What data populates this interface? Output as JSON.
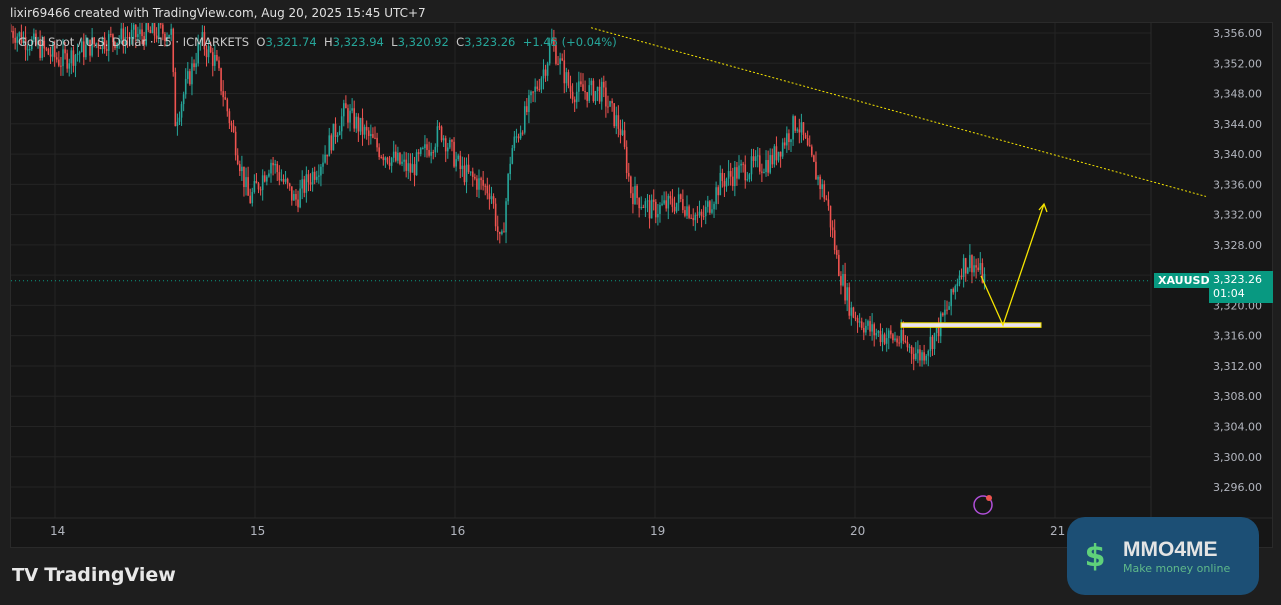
{
  "header": {
    "text": "lixir69466 created with TradingView.com, Aug 20, 2025 15:45 UTC+7"
  },
  "legend": {
    "symbol": "Gold Spot / U.S. Dollar · 15 · ICMARKETS",
    "o_label": "O",
    "o": "3,321.74",
    "h_label": "H",
    "h": "3,323.94",
    "l_label": "L",
    "l": "3,320.92",
    "c_label": "C",
    "c": "3,323.26",
    "change": "+1.45 (+0.04%)"
  },
  "price_axis": {
    "ticks": [
      "3,356.00",
      "3,352.00",
      "3,348.00",
      "3,344.00",
      "3,340.00",
      "3,336.00",
      "3,332.00",
      "3,328.00",
      "3,324.00",
      "3,320.00",
      "3,316.00",
      "3,312.00",
      "3,308.00",
      "3,304.00",
      "3,300.00",
      "3,296.00"
    ],
    "min": 3296,
    "max": 3356
  },
  "time_axis": {
    "labels": [
      "14",
      "15",
      "16",
      "19",
      "20",
      "21"
    ]
  },
  "current": {
    "symbol": "XAUUSD",
    "price": "3,323.26",
    "price_value": 3323.26,
    "countdown": "01:04"
  },
  "colors": {
    "up": "#26a69a",
    "down": "#ef5350",
    "accent": "#089981",
    "annot": "#f5e400"
  },
  "price_path": [
    [
      -0.22,
      3356.3
    ],
    [
      0.03,
      3352.3
    ],
    [
      0.23,
      3355
    ],
    [
      0.58,
      3356.3
    ],
    [
      0.6,
      3344.4
    ],
    [
      0.73,
      3355
    ],
    [
      0.8,
      3352.3
    ],
    [
      0.9,
      3341.7
    ],
    [
      0.97,
      3333.8
    ],
    [
      1.08,
      3339.1
    ],
    [
      1.2,
      3333.8
    ],
    [
      1.33,
      3339.1
    ],
    [
      1.45,
      3345.7
    ],
    [
      1.63,
      3340.4
    ],
    [
      1.78,
      3337.8
    ],
    [
      1.93,
      3343.1
    ],
    [
      2.03,
      3337.8
    ],
    [
      2.18,
      3335.1
    ],
    [
      2.23,
      3327.2
    ],
    [
      2.28,
      3340.4
    ],
    [
      2.38,
      3347
    ],
    [
      2.46,
      3352.3
    ],
    [
      2.48,
      3355
    ],
    [
      2.58,
      3348.3
    ],
    [
      2.73,
      3348.3
    ],
    [
      2.83,
      3343.1
    ],
    [
      2.88,
      3335.1
    ],
    [
      2.98,
      3332.5
    ],
    [
      3.13,
      3333.8
    ],
    [
      3.23,
      3331.2
    ],
    [
      3.33,
      3336.4
    ],
    [
      3.43,
      3337.8
    ],
    [
      3.58,
      3339.1
    ],
    [
      3.71,
      3344.4
    ],
    [
      3.78,
      3339.1
    ],
    [
      3.86,
      3333.8
    ],
    [
      3.91,
      3325.9
    ],
    [
      3.98,
      3319.3
    ],
    [
      4.08,
      3316.6
    ],
    [
      4.23,
      3315.3
    ],
    [
      4.33,
      3313.3
    ],
    [
      4.41,
      3316.6
    ],
    [
      4.48,
      3320.6
    ],
    [
      4.53,
      3325.2
    ],
    [
      4.58,
      3325.9
    ],
    [
      4.655,
      3323.3
    ]
  ],
  "annotations": {
    "trendline": [
      [
        2.68,
        3356.7
      ],
      [
        5.755,
        3334.4
      ]
    ],
    "zone": {
      "from": 4.23,
      "to": 4.93,
      "top": 3317.7,
      "bottom": 3317.1
    },
    "arrow": [
      [
        4.63,
        3323.9
      ],
      [
        4.74,
        3317.4
      ],
      [
        4.945,
        3333.4
      ]
    ]
  },
  "footer": {
    "logo": "TradingView"
  },
  "watermark": {
    "title": "MMO4ME",
    "subtitle": "Make money online"
  }
}
